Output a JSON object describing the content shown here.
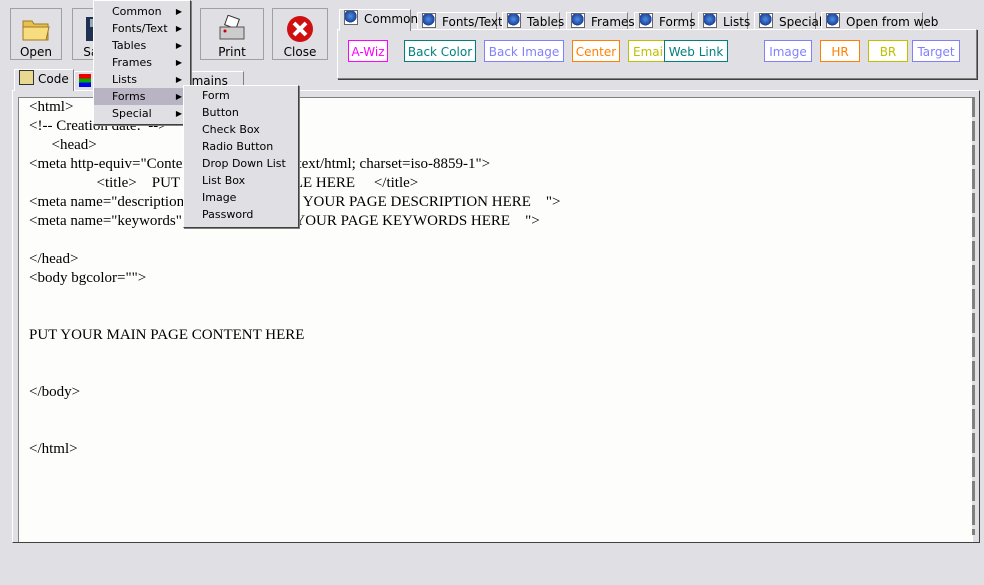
{
  "toolbar": {
    "open": "Open",
    "save": "Save",
    "print": "Print",
    "close": "Close"
  },
  "menu": {
    "items": [
      {
        "label": "Common"
      },
      {
        "label": "Fonts/Text"
      },
      {
        "label": "Tables"
      },
      {
        "label": "Frames"
      },
      {
        "label": "Lists"
      },
      {
        "label": "Forms",
        "highlighted": true
      },
      {
        "label": "Special"
      }
    ]
  },
  "submenu": {
    "items": [
      "Form",
      "Button",
      "Check Box",
      "Radio Button",
      "Drop Down List",
      "List Box",
      "Image",
      "Password"
    ]
  },
  "snippet_tabs": [
    "Common",
    "Fonts/Text",
    "Tables",
    "Frames",
    "Forms",
    "Lists",
    "Special",
    "Open from web"
  ],
  "snippet_buttons": [
    {
      "label": "A-Wiz",
      "color": "#ff00ff"
    },
    {
      "label": "Back Color",
      "color": "#008080"
    },
    {
      "label": "Back Image",
      "color": "#8080ff"
    },
    {
      "label": "Center",
      "color": "#ff8000"
    },
    {
      "label": "EmailTo",
      "color": "#c0c000"
    },
    {
      "label": "Web Link",
      "color": "#008080"
    },
    {
      "label": "Image",
      "color": "#8080ff"
    },
    {
      "label": "HR",
      "color": "#ff8000"
    },
    {
      "label": "BR",
      "color": "#c0c000"
    },
    {
      "label": "Target",
      "color": "#8080ff"
    }
  ],
  "editor_tabs": [
    "Code",
    "",
    "Domains"
  ],
  "code_lines": [
    "<html>",
    "<!-- Creation date:  -->",
    "      <head>",
    "<meta http-equiv=\"Content-Type\" content=\"text/html; charset=iso-8859-1\">",
    "                  <title>    PUT YOUR PAGE TITLE HERE     </title>",
    "<meta name=\"description\" content=\"     PUT YOUR PAGE DESCRIPTION HERE    \">",
    "<meta name=\"keywords\" content=\"     PUT YOUR PAGE KEYWORDS HERE    \">",
    "",
    "</head>",
    "<body bgcolor=\"\">",
    "",
    "",
    "PUT YOUR MAIN PAGE CONTENT HERE",
    "",
    "",
    "</body>",
    "",
    "",
    "</html>"
  ]
}
